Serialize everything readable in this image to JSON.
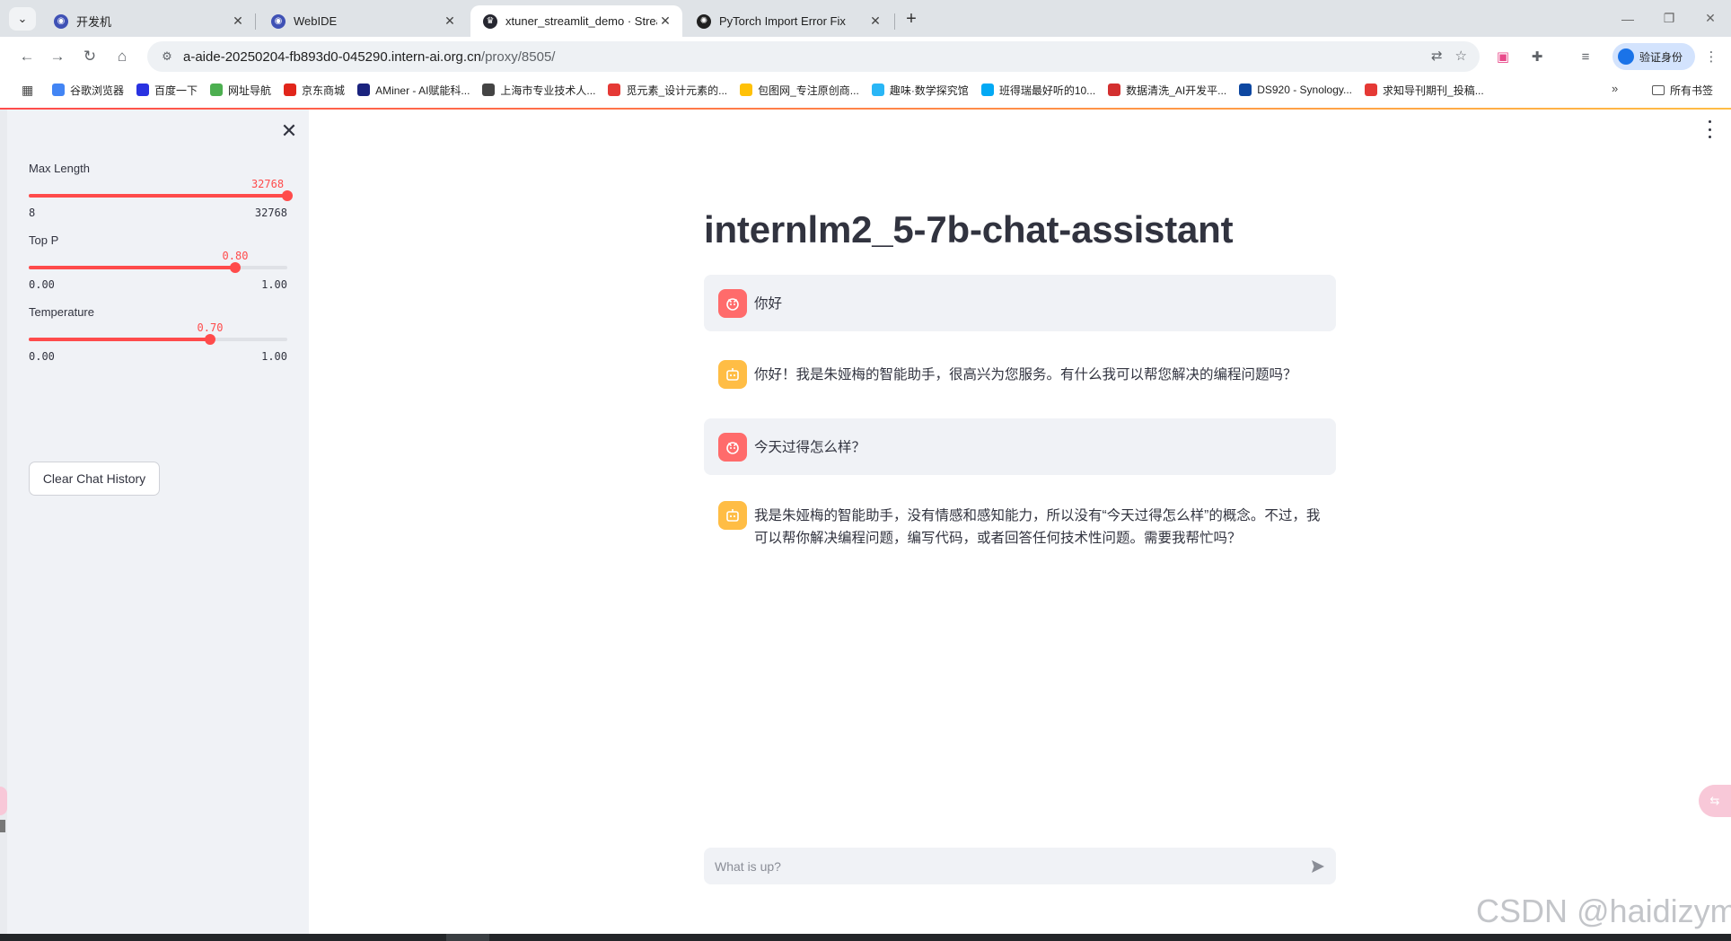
{
  "browser": {
    "tabs": [
      {
        "title": "开发机",
        "active": false
      },
      {
        "title": "WebIDE",
        "active": false
      },
      {
        "title": "xtuner_streamlit_demo · Strea",
        "active": true
      },
      {
        "title": "PyTorch Import Error Fix",
        "active": false
      }
    ],
    "url_host": "a-aide-20250204-fb893d0-045290.intern-ai.org.cn",
    "url_path": "/proxy/8505/",
    "profile_label": "验证身份",
    "bookmarks": [
      {
        "label": "谷歌浏览器",
        "color": "#4285f4"
      },
      {
        "label": "百度一下",
        "color": "#2932e1"
      },
      {
        "label": "网址导航",
        "color": "#4caf50"
      },
      {
        "label": "京东商城",
        "color": "#e1251b"
      },
      {
        "label": "AMiner - AI赋能科...",
        "color": "#1a237e"
      },
      {
        "label": "上海市专业技术人...",
        "color": "#444444"
      },
      {
        "label": "觅元素_设计元素的...",
        "color": "#e53935"
      },
      {
        "label": "包图网_专注原创商...",
        "color": "#ffc107"
      },
      {
        "label": "趣味·数学探究馆",
        "color": "#29b6f6"
      },
      {
        "label": "班得瑞最好听的10...",
        "color": "#03a9f4"
      },
      {
        "label": "数据清洗_AI开发平...",
        "color": "#d32f2f"
      },
      {
        "label": "DS920 - Synology...",
        "color": "#0d47a1"
      },
      {
        "label": "求知导刊期刊_投稿...",
        "color": "#e53935"
      }
    ],
    "bookmarks_overflow": "»",
    "all_bookmarks_label": "所有书签"
  },
  "sidebar": {
    "sliders": [
      {
        "label": "Max Length",
        "value_text": "32768",
        "min_text": "8",
        "max_text": "32768",
        "fraction": 1.0
      },
      {
        "label": "Top P",
        "value_text": "0.80",
        "min_text": "0.00",
        "max_text": "1.00",
        "fraction": 0.8
      },
      {
        "label": "Temperature",
        "value_text": "0.70",
        "min_text": "0.00",
        "max_text": "1.00",
        "fraction": 0.7
      }
    ],
    "clear_button_label": "Clear Chat History"
  },
  "main": {
    "title": "internlm2_5-7b-chat-assistant",
    "messages": [
      {
        "role": "user",
        "text": "你好"
      },
      {
        "role": "assistant",
        "text": "你好！我是朱娅梅的智能助手，很高兴为您服务。有什么我可以帮您解决的编程问题吗？"
      },
      {
        "role": "user",
        "text": "今天过得怎么样？"
      },
      {
        "role": "assistant",
        "text": "我是朱娅梅的智能助手，没有情感和感知能力，所以没有“今天过得怎么样”的概念。不过，我可以帮你解决编程问题，编写代码，或者回答任何技术性问题。需要我帮忙吗？"
      }
    ],
    "chat_input_placeholder": "What is up?"
  },
  "watermark": "CSDN @haidizym",
  "colors": {
    "accent": "#ff4b4b",
    "sidebar_bg": "#f0f2f6",
    "user_avatar": "#ff6b6b",
    "assistant_avatar": "#ffbd45",
    "text": "#31333f"
  }
}
